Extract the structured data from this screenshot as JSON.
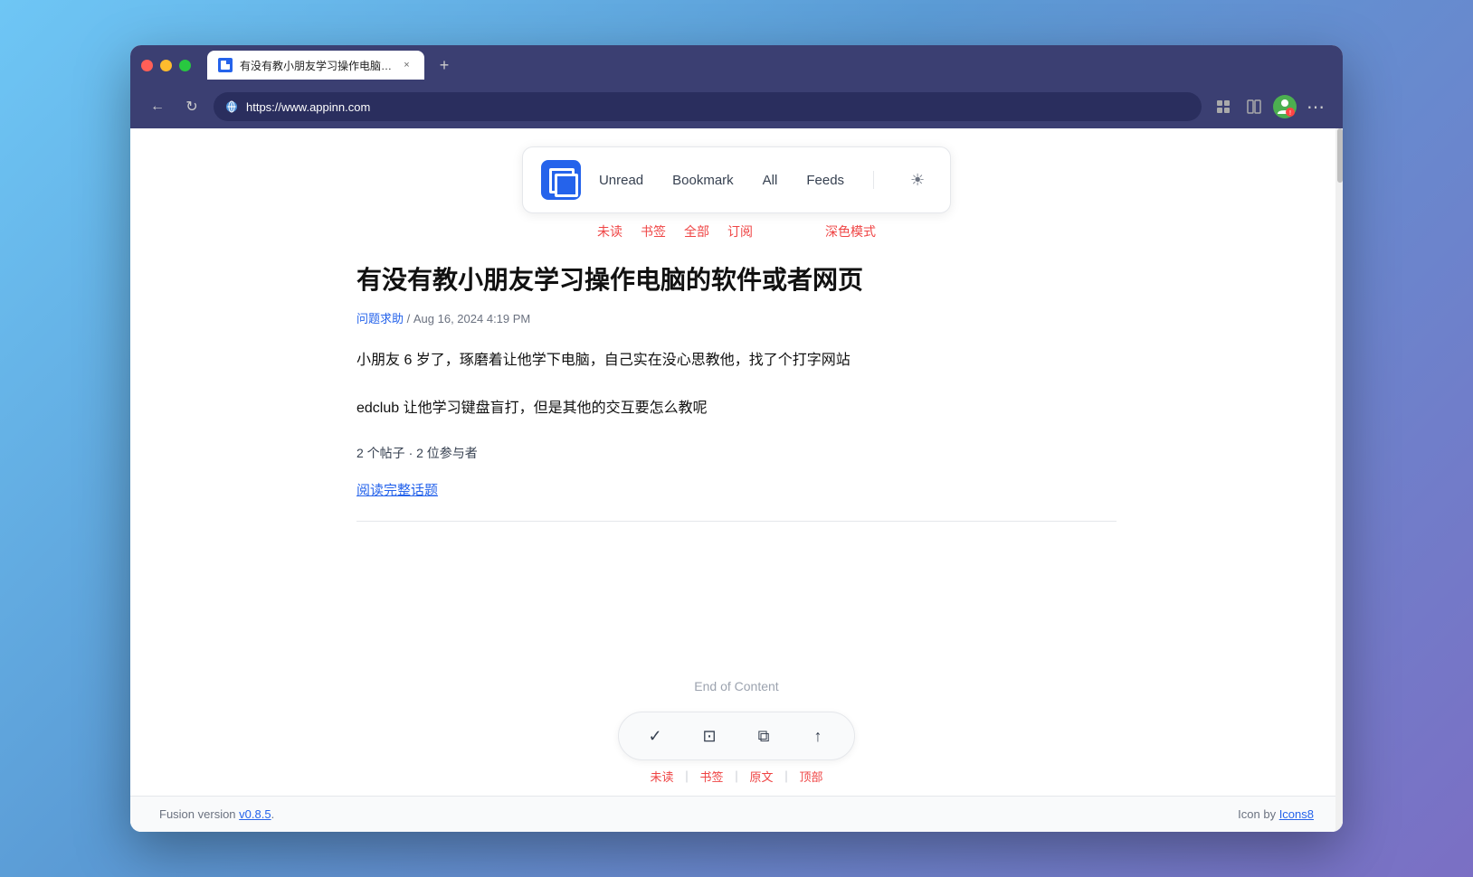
{
  "browser": {
    "tab_label": "有没有教小朋友学习操作电脑的...",
    "tab_close": "×",
    "new_tab": "+",
    "address": "https://www.appinn.com",
    "nav_back": "←",
    "nav_refresh": "↻"
  },
  "nav": {
    "unread": "Unread",
    "bookmark": "Bookmark",
    "all": "All",
    "feeds": "Feeds",
    "theme_icon": "☀",
    "unread_cn": "未读",
    "bookmark_cn": "书签",
    "all_cn": "全部",
    "feeds_cn": "订阅",
    "theme_cn": "深色模式"
  },
  "article": {
    "title": "有没有教小朋友学习操作电脑的软件或者网页",
    "meta_category": "问题求助",
    "meta_date": "Aug 16, 2024 4:19 PM",
    "body1": "小朋友 6 岁了，琢磨着让他学下电脑，自己实在没心思教他，找了个打字网站",
    "body2": "edclub 让他学习键盘盲打，但是其他的交互要怎么教呢",
    "stats": "2 个帖子 · 2 位参与者",
    "read_full": "阅读完整话题",
    "end_of_content": "End of Content"
  },
  "bottom_bar": {
    "mark_icon": "✓",
    "bookmark_icon": "⊡",
    "external_icon": "⧉",
    "top_icon": "↑",
    "unread_label": "未读",
    "sep1": "｜",
    "bookmark_label": "书签",
    "sep2": "｜",
    "original_label": "原文",
    "sep3": "｜",
    "top_label": "顶部"
  },
  "footer": {
    "version_text": "Fusion version ",
    "version_link": "v0.8.5",
    "version_period": ".",
    "icon_text": "Icon by ",
    "icon_link": "Icons8"
  }
}
